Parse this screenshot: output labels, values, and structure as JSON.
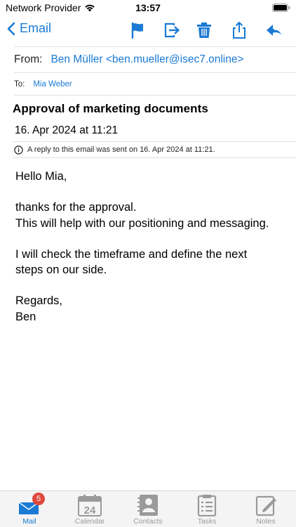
{
  "status": {
    "carrier": "Network Provider",
    "time": "13:57"
  },
  "nav": {
    "back_label": "Email"
  },
  "email": {
    "from_label": "From:",
    "from_value": "Ben Müller <ben.mueller@isec7.online>",
    "to_label": "To:",
    "to_value": "Mia Weber",
    "subject": "Approval of marketing documents",
    "date": "16. Apr 2024 at 11:21",
    "reply_note": "A reply to this email was sent on 16. Apr 2024 at 11:21.",
    "body": {
      "greeting": "Hello Mia,",
      "line1": "thanks for the approval.",
      "line2": "This will help with our positioning and messaging.",
      "line3": "I will check the timeframe and define the next",
      "line4": "steps on our side.",
      "closing": "Regards,",
      "signature": "Ben"
    }
  },
  "tabs": {
    "mail": "Mail",
    "mail_badge": "5",
    "calendar": "Calendar",
    "calendar_day": "24",
    "contacts": "Contacts",
    "tasks": "Tasks",
    "notes": "Notes"
  },
  "colors": {
    "accent": "#1a7ad4",
    "badge": "#e0483c",
    "inactive": "#9a9a9a"
  }
}
